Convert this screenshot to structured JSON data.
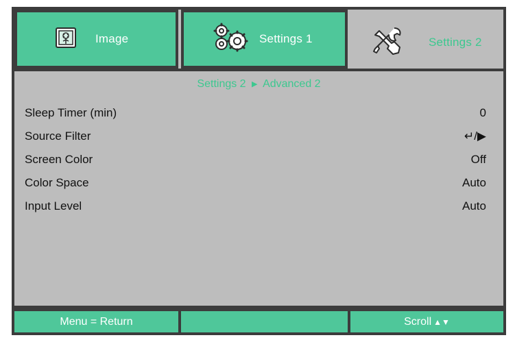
{
  "tabs": {
    "image": {
      "label": "Image",
      "icon": "image-icon"
    },
    "settings1": {
      "label": "Settings 1",
      "icon": "gears-icon"
    },
    "settings2": {
      "label": "Settings 2",
      "icon": "wrench-screwdriver-icon"
    }
  },
  "breadcrumb": {
    "parent": "Settings 2",
    "separator": "▶",
    "current": "Advanced 2"
  },
  "settings": [
    {
      "label": "Sleep Timer (min)",
      "value": "0"
    },
    {
      "label": "Source Filter",
      "value": "↵/▶"
    },
    {
      "label": "Screen Color",
      "value": "Off"
    },
    {
      "label": "Color Space",
      "value": "Auto"
    },
    {
      "label": "Input Level",
      "value": "Auto"
    }
  ],
  "footer": {
    "left": "Menu = Return",
    "middle": "",
    "right_label": "Scroll",
    "right_arrows": "▲▼"
  },
  "colors": {
    "accent_green": "#4fc79a",
    "active_text_green": "#3cc88f",
    "panel_gray": "#bdbdbd",
    "border_dark": "#3c3c3c"
  }
}
